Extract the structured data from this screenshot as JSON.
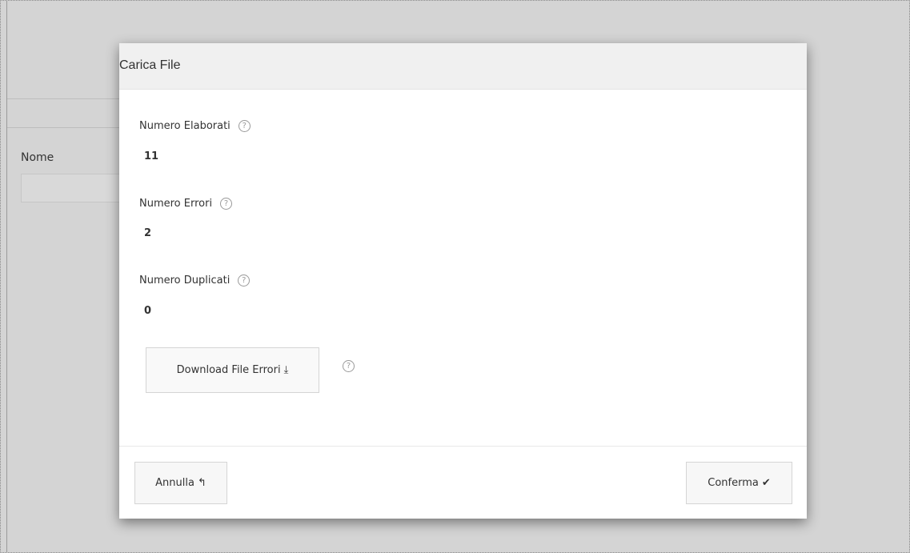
{
  "background": {
    "form_label": "Nome"
  },
  "modal": {
    "title": "Carica File",
    "fields": [
      {
        "label": "Numero Elaborati",
        "value": "11",
        "help_icon": "question-circle"
      },
      {
        "label": "Numero Errori",
        "value": "2",
        "help_icon": "question-circle"
      },
      {
        "label": "Numero Duplicati",
        "value": "0",
        "help_icon": "question-circle"
      }
    ],
    "download_button": {
      "label": "Download File Errori",
      "icon": "download-icon"
    },
    "download_help_icon": "question-circle",
    "footer": {
      "cancel_label": "Annulla",
      "cancel_icon": "reply-icon",
      "confirm_label": "Conferma",
      "confirm_icon": "check-icon"
    }
  },
  "colors": {
    "overlay": "#d4d4d4",
    "modal_header": "#f0f0f0",
    "button_bg": "#f7f7f7"
  }
}
